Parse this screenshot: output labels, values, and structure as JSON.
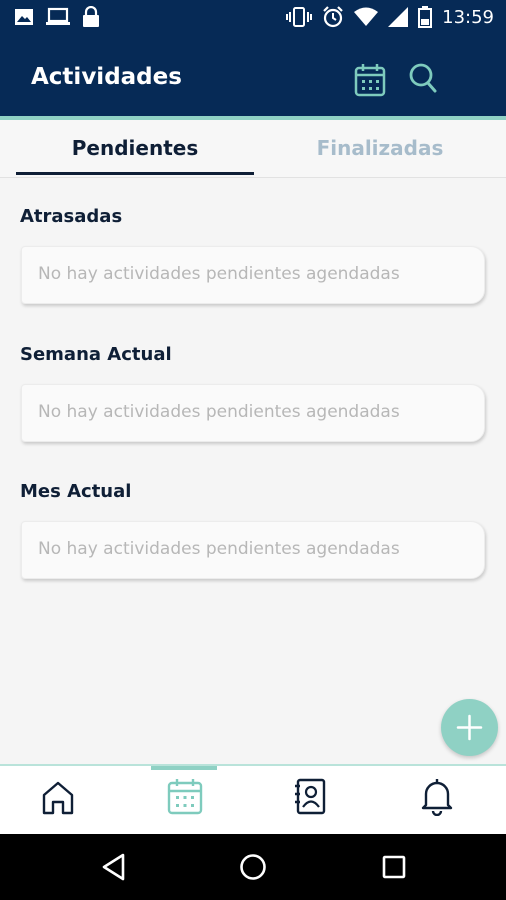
{
  "status_bar": {
    "time": "13:59",
    "left_icons": [
      "image-icon",
      "laptop-icon",
      "lock-icon"
    ],
    "right_icons": [
      "vibrate-icon",
      "alarm-icon",
      "wifi-icon",
      "signal-icon",
      "battery-icon"
    ]
  },
  "app_bar": {
    "title": "Actividades",
    "icons": [
      "calendar-icon",
      "search-icon"
    ]
  },
  "tabs": [
    {
      "label": "Pendientes",
      "active": true
    },
    {
      "label": "Finalizadas",
      "active": false
    }
  ],
  "sections": [
    {
      "title": "Atrasadas",
      "empty_message": "No hay actividades pendientes agendadas"
    },
    {
      "title": "Semana Actual",
      "empty_message": "No hay actividades pendientes agendadas"
    },
    {
      "title": "Mes Actual",
      "empty_message": "No hay actividades pendientes agendadas"
    }
  ],
  "fab": {
    "icon": "plus-icon"
  },
  "bottom_nav": [
    {
      "icon": "home-icon",
      "active": false
    },
    {
      "icon": "calendar-icon",
      "active": true
    },
    {
      "icon": "contacts-icon",
      "active": false
    },
    {
      "icon": "bell-icon",
      "active": false
    }
  ],
  "system_nav": [
    "back-icon",
    "home-circle-icon",
    "recents-icon"
  ],
  "colors": {
    "primary": "#062a56",
    "accent": "#8fd1c4",
    "tab_inactive": "#a7bccb",
    "background": "#f5f5f5"
  }
}
